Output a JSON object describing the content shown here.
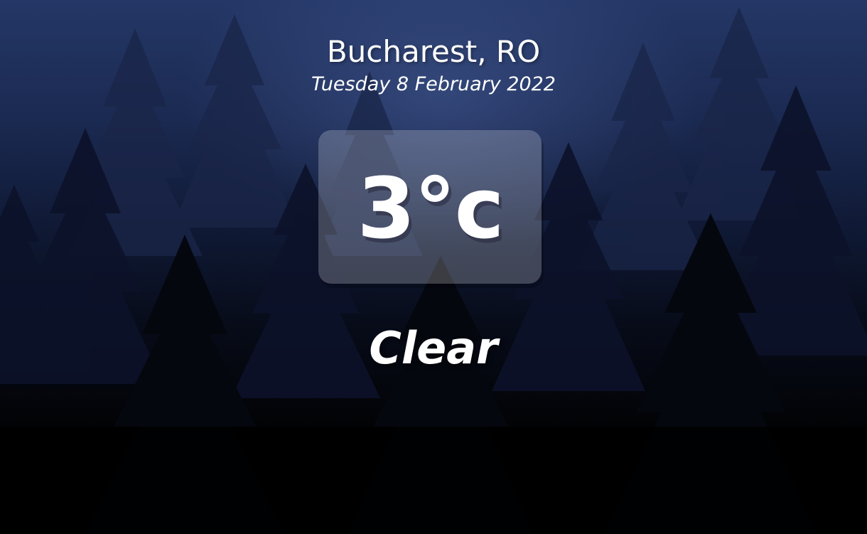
{
  "weather": {
    "location": "Bucharest, RO",
    "date": "Tuesday 8 February 2022",
    "temperature": "3°c",
    "condition": "Clear"
  },
  "background": {
    "scene": "night pine forest",
    "colors": {
      "sky_top": "#243766",
      "sky_mid": "#101a36",
      "ground": "#000000"
    }
  }
}
